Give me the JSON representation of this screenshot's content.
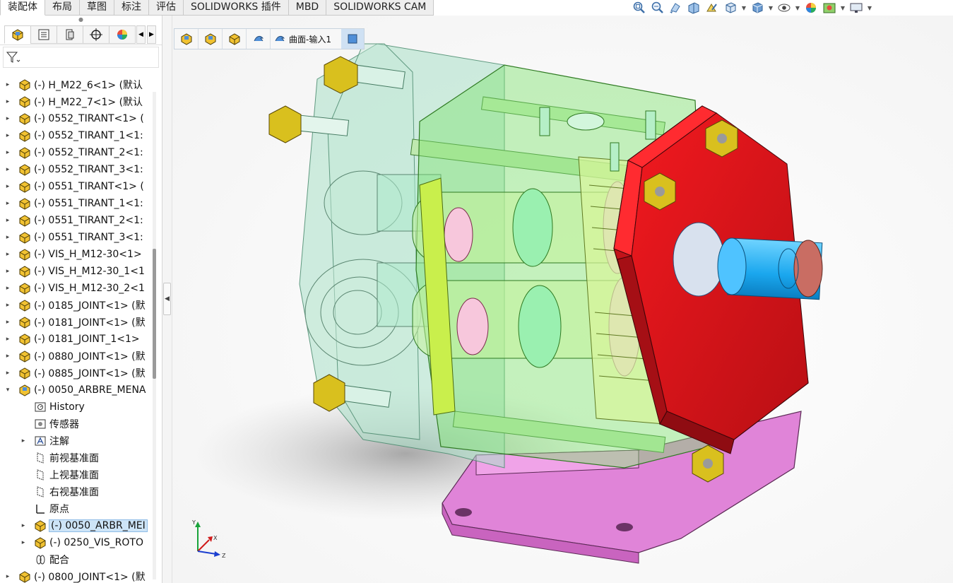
{
  "ribbon": {
    "tabs": [
      "装配体",
      "布局",
      "草图",
      "标注",
      "评估",
      "SOLIDWORKS 插件",
      "MBD",
      "SOLIDWORKS CAM"
    ],
    "active": "装配体"
  },
  "view_toolbar": {
    "icons": [
      "zoom-to-fit-icon",
      "zoom-to-area-icon",
      "previous-view-icon",
      "section-view-icon",
      "dynamic-annotation-icon",
      "view-orientation-icon",
      "display-style-icon",
      "hide-show-icon",
      "edit-appearance-icon",
      "apply-scene-icon",
      "view-settings-icon"
    ]
  },
  "feature_manager": {
    "tabs": [
      "featuremanager-tab",
      "propertymanager-tab",
      "configurationmanager-tab",
      "dimxpert-tab",
      "display-manager-tab"
    ],
    "filter_icon": "filter-icon",
    "tree": [
      {
        "label": "(-) H_M22_6<1> (默认",
        "icon": "part",
        "expand": "right"
      },
      {
        "label": "(-) H_M22_7<1> (默认",
        "icon": "part",
        "expand": "right"
      },
      {
        "label": "(-) 0552_TIRANT<1> (",
        "icon": "part",
        "expand": "right"
      },
      {
        "label": "(-) 0552_TIRANT_1<1:",
        "icon": "part",
        "expand": "right"
      },
      {
        "label": "(-) 0552_TIRANT_2<1:",
        "icon": "part",
        "expand": "right"
      },
      {
        "label": "(-) 0552_TIRANT_3<1:",
        "icon": "part",
        "expand": "right"
      },
      {
        "label": "(-) 0551_TIRANT<1> (",
        "icon": "part",
        "expand": "right"
      },
      {
        "label": "(-) 0551_TIRANT_1<1:",
        "icon": "part",
        "expand": "right"
      },
      {
        "label": "(-) 0551_TIRANT_2<1:",
        "icon": "part",
        "expand": "right"
      },
      {
        "label": "(-) 0551_TIRANT_3<1:",
        "icon": "part",
        "expand": "right"
      },
      {
        "label": "(-) VIS_H_M12-30<1>",
        "icon": "part",
        "expand": "right"
      },
      {
        "label": "(-) VIS_H_M12-30_1<1",
        "icon": "part",
        "expand": "right"
      },
      {
        "label": "(-) VIS_H_M12-30_2<1",
        "icon": "part",
        "expand": "right"
      },
      {
        "label": "(-) 0185_JOINT<1> (默",
        "icon": "part",
        "expand": "right"
      },
      {
        "label": "(-) 0181_JOINT<1> (默",
        "icon": "part",
        "expand": "right"
      },
      {
        "label": "(-) 0181_JOINT_1<1>",
        "icon": "part",
        "expand": "right"
      },
      {
        "label": "(-) 0880_JOINT<1> (默",
        "icon": "part",
        "expand": "right"
      },
      {
        "label": "(-) 0885_JOINT<1> (默",
        "icon": "part",
        "expand": "right"
      },
      {
        "label": "(-) 0050_ARBRE_MENA",
        "icon": "assembly",
        "expand": "down"
      },
      {
        "label": "History",
        "icon": "history",
        "expand": "none",
        "indent": 1
      },
      {
        "label": "传感器",
        "icon": "sensor",
        "expand": "none",
        "indent": 1
      },
      {
        "label": "注解",
        "icon": "annotation",
        "expand": "right",
        "indent": 1
      },
      {
        "label": "前视基准面",
        "icon": "plane",
        "expand": "none",
        "indent": 1
      },
      {
        "label": "上视基准面",
        "icon": "plane",
        "expand": "none",
        "indent": 1
      },
      {
        "label": "右视基准面",
        "icon": "plane",
        "expand": "none",
        "indent": 1
      },
      {
        "label": "原点",
        "icon": "origin",
        "expand": "none",
        "indent": 1
      },
      {
        "label": "(-) 0050_ARBR_MEI",
        "icon": "part",
        "expand": "right",
        "indent": 1,
        "selected": true
      },
      {
        "label": "(-) 0250_VIS_ROTO",
        "icon": "part",
        "expand": "right",
        "indent": 1
      },
      {
        "label": "配合",
        "icon": "mates",
        "expand": "none",
        "indent": 1
      },
      {
        "label": "(-) 0800_JOINT<1> (默",
        "icon": "part",
        "expand": "right"
      }
    ]
  },
  "breadcrumb": {
    "icons": [
      "assembly-crumb-icon",
      "subassembly-crumb-icon",
      "part-crumb-icon",
      "feature-crumb-icon"
    ],
    "label": "曲面-输入1",
    "label_icon": "surface-feature-icon",
    "end_icon": "face-select-icon"
  },
  "triad": {
    "x": "X",
    "y": "Y",
    "z": "Z"
  },
  "colors": {
    "housing_transparent": "#9fdcbc",
    "gear_green": "#7fe36f",
    "end_cover_red": "#e8141b",
    "shaft_blue": "#28b6f3",
    "base_pink": "#e17ad6",
    "nut_gold": "#d9c01e",
    "selection_blue": "#cde4f7"
  }
}
